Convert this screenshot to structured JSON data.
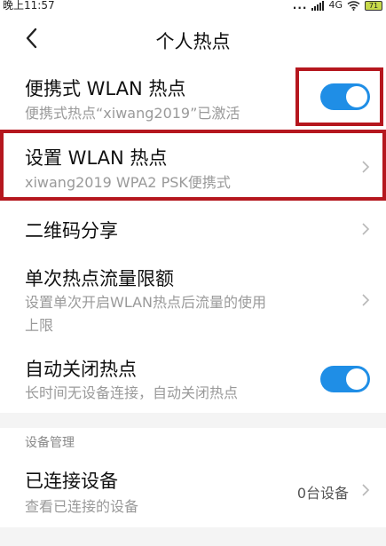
{
  "status_bar": {
    "time": "晚上11:57",
    "dots": "...",
    "network": "4G",
    "battery": "71"
  },
  "header": {
    "title": "个人热点"
  },
  "settings": {
    "portable_hotspot": {
      "title": "便携式 WLAN 热点",
      "subtitle": "便携式热点“xiwang2019”已激活",
      "enabled": true
    },
    "setup_hotspot": {
      "title": "设置 WLAN 热点",
      "subtitle": "xiwang2019 WPA2 PSK便携式"
    },
    "qr_share": {
      "title": "二维码分享"
    },
    "data_limit": {
      "title": "单次热点流量限额",
      "subtitle_line1": "设置单次开启WLAN热点后流量的使用",
      "subtitle_line2": "上限"
    },
    "auto_off": {
      "title": "自动关闭热点",
      "subtitle": "长时间无设备连接，自动关闭热点",
      "enabled": true
    }
  },
  "device_management": {
    "section_label": "设备管理",
    "connected_devices": {
      "title": "已连接设备",
      "subtitle": "查看已连接的设备",
      "value": "0台设备"
    }
  },
  "colors": {
    "toggle_on": "#1f8ee6",
    "highlight_box": "#b5171e"
  }
}
